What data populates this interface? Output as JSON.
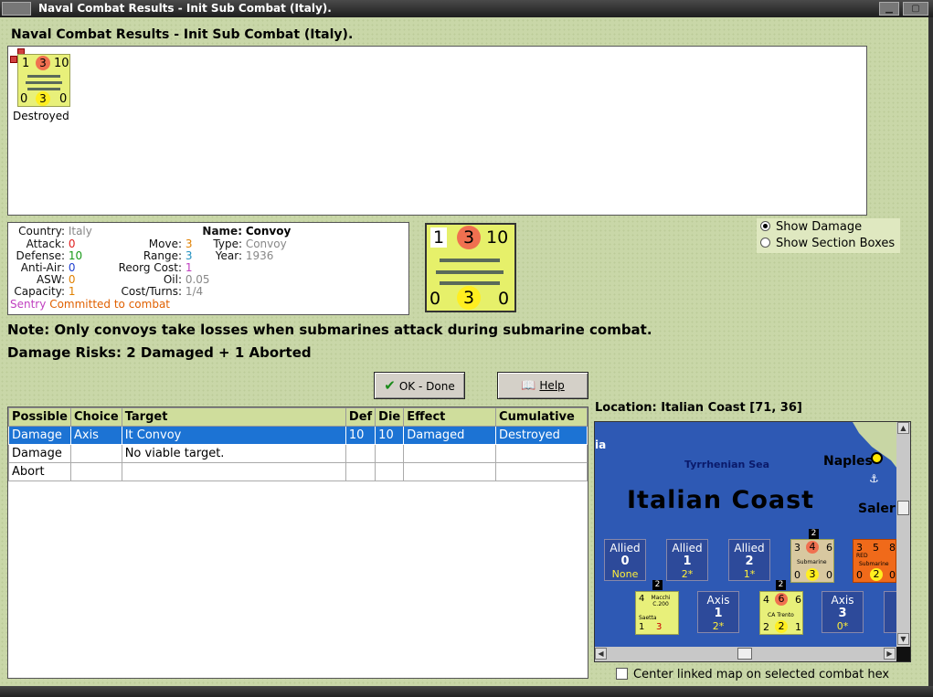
{
  "window": {
    "title": "Naval Combat Results - Init Sub Combat (Italy)."
  },
  "heading": "Naval Combat Results - Init Sub Combat (Italy).",
  "results": {
    "unit": {
      "top_values": [
        "1",
        "3",
        "10"
      ],
      "bottom_values": [
        "0",
        "3",
        "0"
      ],
      "status": "Destroyed"
    }
  },
  "unit_info": {
    "country_label": "Country:",
    "country": "Italy",
    "attack_label": "Attack:",
    "attack": "0",
    "defense_label": "Defense:",
    "defense": "10",
    "antiair_label": "Anti-Air:",
    "antiair": "0",
    "asw_label": "ASW:",
    "asw": "0",
    "capacity_label": "Capacity:",
    "capacity": "1",
    "sentry_label": "Sentry",
    "sentry_value": "Committed to combat",
    "move_label": "Move:",
    "move": "3",
    "range_label": "Range:",
    "range": "3",
    "reorg_label": "Reorg Cost:",
    "reorg": "1",
    "oil_label": "Oil:",
    "oil": "0.05",
    "cost_label": "Cost/Turns:",
    "cost": "1/4",
    "name_label": "Name:",
    "name": "Convoy",
    "type_label": "Type:",
    "type": "Convoy",
    "year_label": "Year:",
    "year": "1936",
    "colors": {
      "attack": "#e02020",
      "defense": "#1a9a1a",
      "antiair": "#2040d0",
      "asw": "#e08000",
      "capacity": "#e08000",
      "sentry": "#c040c0",
      "committed": "#e06000",
      "move": "#e08000",
      "range": "#2090c0",
      "reorg": "#c040c0",
      "grey": "#888888"
    }
  },
  "big_counter": {
    "top_values": [
      "1",
      "3",
      "10"
    ],
    "bottom_values": [
      "0",
      "3",
      "0"
    ]
  },
  "display_options": {
    "show_damage": "Show Damage",
    "show_section_boxes": "Show Section Boxes",
    "selected": "show_damage"
  },
  "note": "Note: Only convoys take losses when submarines attack during submarine combat.",
  "damage_risks": "Damage Risks:  2 Damaged + 1 Aborted",
  "buttons": {
    "ok_done": "OK - Done",
    "help": "Help"
  },
  "combat_table": {
    "headers": [
      "Possible",
      "Choice",
      "Target",
      "Def",
      "Die",
      "Effect",
      "Cumulative"
    ],
    "rows": [
      [
        "Damage",
        "Axis",
        "It Convoy",
        "10",
        "10",
        "Damaged",
        "Destroyed"
      ],
      [
        "Damage",
        "",
        "No viable target.",
        "",
        "",
        "",
        ""
      ],
      [
        "Abort",
        "",
        "",
        "",
        "",
        "",
        ""
      ]
    ],
    "selected_row": 0
  },
  "location": {
    "label": "Location:  Italian Coast [71, 36]"
  },
  "map": {
    "sea_name": "Tyrrhenian Sea",
    "region_name": "Italian Coast",
    "city_naples": "Naples",
    "city_salerno_partial": "Saler",
    "partial_left_text": "ia",
    "allied_boxes": [
      {
        "side": "Allied",
        "number": "0",
        "status": "None"
      },
      {
        "side": "Allied",
        "number": "1",
        "status": "2*"
      },
      {
        "side": "Allied",
        "number": "2",
        "status": "1*"
      }
    ],
    "axis_boxes": [
      {
        "side": "Axis",
        "number": "1",
        "status": "2*"
      },
      {
        "side": "Axis",
        "number": "3",
        "status": "0*"
      }
    ],
    "units": {
      "allied_sub": {
        "stack": "2",
        "top": [
          "3",
          "4",
          "6"
        ],
        "name": "Submarine",
        "bottom": [
          "0",
          "3",
          "0"
        ]
      },
      "red_sub": {
        "top": [
          "3",
          "5",
          "8"
        ],
        "tag": "RED",
        "name": "Submarine",
        "bottom": [
          "0",
          "2",
          "0"
        ]
      },
      "macchi": {
        "stack": "2",
        "top": [
          "4"
        ],
        "name": "Macchi C.200",
        "sub": "Saetta",
        "bottom": [
          "1",
          "3"
        ]
      },
      "trento": {
        "stack": "2",
        "top": [
          "4",
          "6",
          "6"
        ],
        "name": "CA Trento",
        "bottom": [
          "2",
          "2",
          "1"
        ]
      }
    }
  },
  "center_map_label": "Center linked map on selected combat hex",
  "center_map_checked": false
}
